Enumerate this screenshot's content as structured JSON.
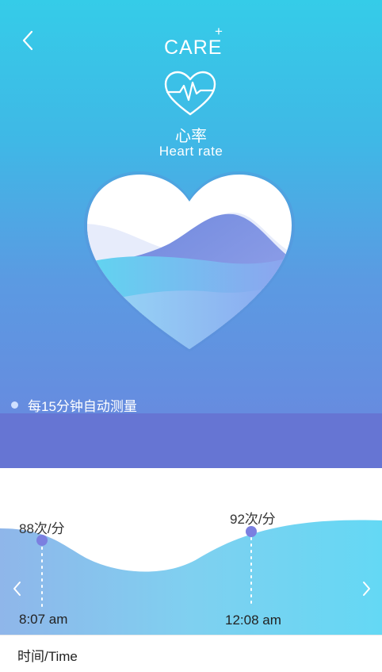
{
  "header": {
    "brand": "CARE",
    "brand_plus": "+",
    "title_cn": "心率",
    "title_en": "Heart rate"
  },
  "note": "每15分钟自动测量",
  "chart": {
    "readings": [
      {
        "value_label": "88次/分",
        "time_label": "8:07 am"
      },
      {
        "value_label": "92次/分",
        "time_label": "12:08 am"
      }
    ]
  },
  "footer": {
    "label": "时间/Time"
  },
  "colors": {
    "accent": "#7b7fe0",
    "hero_top": "#35cce8",
    "hero_bottom": "#6b86de",
    "band": "#6675d3"
  }
}
